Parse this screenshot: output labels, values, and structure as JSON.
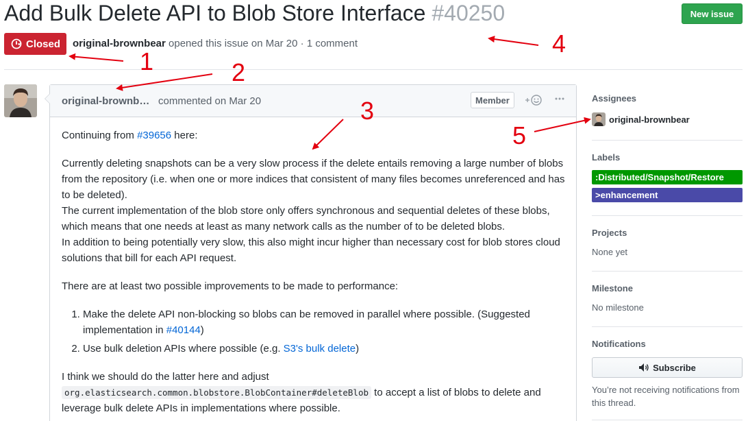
{
  "issue": {
    "title": "Add Bulk Delete API to Blob Store Interface",
    "number": "#40250",
    "state_label": "Closed",
    "author": "original-brownbear",
    "opened_text": "opened this issue on Mar 20",
    "separator": "·",
    "comment_count": "1 comment"
  },
  "header": {
    "new_issue_label": "New issue"
  },
  "comment": {
    "author": "original-brownb…",
    "time": "commented on Mar 20",
    "badge": "Member",
    "react_icon": "smiley-add-icon",
    "more_icon": "kebab-horizontal-icon",
    "p1_prefix": "Continuing from ",
    "p1_link": "#39656",
    "p1_suffix": " here:",
    "p2_lines": [
      "Currently deleting snapshots can be a very slow process if the delete entails removing a large number of blobs from the repository (i.e. when one or more indices that consistent of many files becomes unreferenced and has to be deleted).",
      "The current implementation of the blob store only offers synchronous and sequential deletes of these blobs, which means that one needs at least as many network calls as the number of to be deleted blobs.",
      "In addition to being potentially very slow, this also might incur higher than necessary cost for blob stores cloud solutions that bill for each API request."
    ],
    "p3": "There are at least two possible improvements to be made to performance:",
    "li1_text": "Make the delete API non-blocking so blobs can be removed in parallel where possible. (Suggested implementation in ",
    "li1_link": "#40144",
    "li1_suffix": ")",
    "li2_text": "Use bulk deletion APIs where possible (e.g. ",
    "li2_link": "S3's bulk delete",
    "li2_suffix": ")",
    "p4_prefix": "I think we should do the latter here and adjust ",
    "p4_code": "org.elasticsearch.common.blobstore.BlobContainer#deleteBlob",
    "p4_suffix": " to accept a list of blobs to delete and leverage bulk delete APIs in implementations where possible."
  },
  "sidebar": {
    "assignees_heading": "Assignees",
    "assignee": "original-brownbear",
    "labels_heading": "Labels",
    "labels": [
      {
        "text": ":Distributed/Snapshot/Restore",
        "color": "#009800"
      },
      {
        "text": ">enhancement",
        "color": "#4a4aa8"
      }
    ],
    "projects_heading": "Projects",
    "projects_value": "None yet",
    "milestone_heading": "Milestone",
    "milestone_value": "No milestone",
    "notifications_heading": "Notifications",
    "subscribe_label": "Subscribe",
    "notif_text": "You’re not receiving notifications from this thread."
  },
  "annotations": [
    "1",
    "2",
    "3",
    "4",
    "5"
  ],
  "colors": {
    "closed": "#cb2431",
    "new_issue": "#2ea44f",
    "link": "#0366d6",
    "annotation": "#e3000f"
  }
}
